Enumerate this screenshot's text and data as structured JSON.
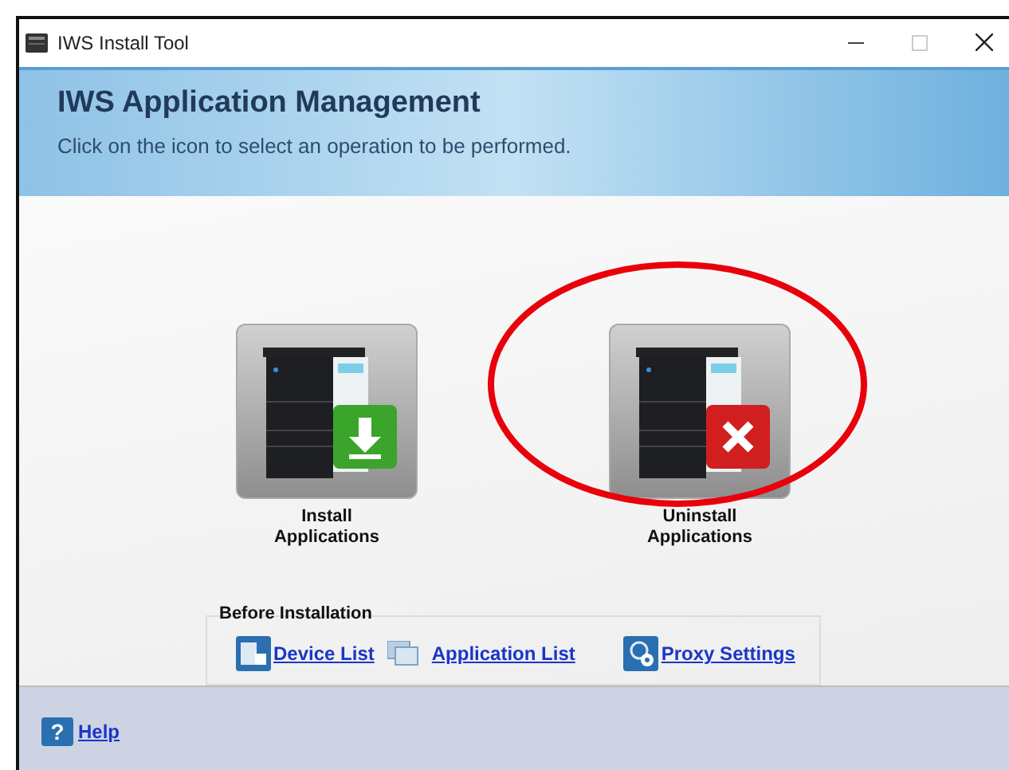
{
  "window": {
    "title": "IWS Install Tool"
  },
  "header": {
    "title": "IWS Application Management",
    "subtitle": "Click on the icon to select an operation to be performed."
  },
  "operations": [
    {
      "kind": "install",
      "label_lines": [
        "Install",
        "Applications"
      ],
      "highlighted": false
    },
    {
      "kind": "uninstall",
      "label_lines": [
        "Uninstall",
        "Applications"
      ],
      "highlighted": true
    }
  ],
  "annotation": {
    "color": "#e8000b"
  },
  "before_installation": {
    "title": "Before Installation",
    "links": [
      {
        "kind": "device",
        "label": "Device List"
      },
      {
        "kind": "application",
        "label": "Application List"
      },
      {
        "kind": "proxy",
        "label": "Proxy Settings"
      }
    ]
  },
  "footer": {
    "help": "Help",
    "help_icon": "?"
  }
}
